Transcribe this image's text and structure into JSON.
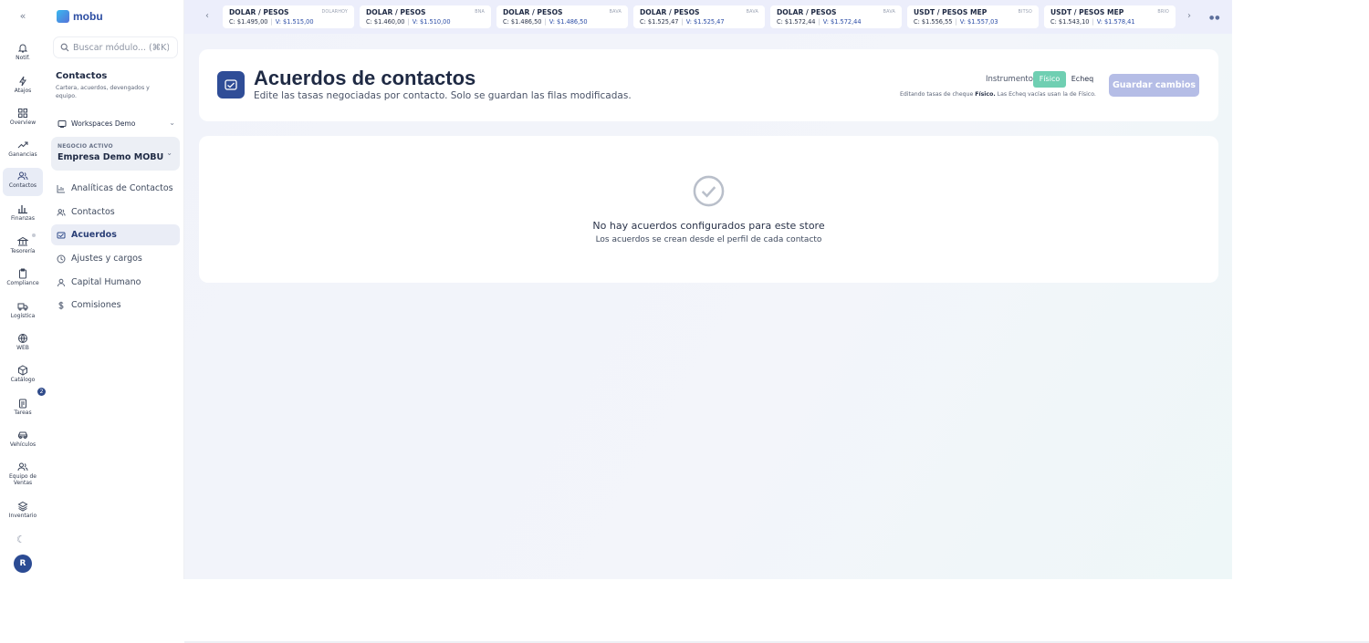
{
  "rail": {
    "items": [
      {
        "label": "Notif."
      },
      {
        "label": "Atajos"
      },
      {
        "label": "Overview"
      },
      {
        "label": "Ganancias"
      },
      {
        "label": "Contactos"
      },
      {
        "label": "Finanzas"
      },
      {
        "label": "Tesorería"
      },
      {
        "label": "Compliance"
      },
      {
        "label": "Logística"
      },
      {
        "label": "WEB"
      },
      {
        "label": "Catálogo"
      },
      {
        "label": "Tareas"
      },
      {
        "label": "Vehículos"
      },
      {
        "label": "Equipo de Ventas"
      },
      {
        "label": "Inventario"
      }
    ],
    "tasks_badge": "2",
    "avatar_initial": "R"
  },
  "sidebar": {
    "logo": "mobu",
    "search_placeholder": "Buscar módulo... (⌘K)",
    "section_title": "Contactos",
    "section_subtitle": "Cartera, acuerdos, devengados y equipo.",
    "workspace": "Workspaces Demo",
    "business_label": "NEGOCIO ACTIVO",
    "business_name": "Empresa Demo MOBU",
    "nav": [
      {
        "label": "Analíticas de Contactos"
      },
      {
        "label": "Contactos"
      },
      {
        "label": "Acuerdos"
      },
      {
        "label": "Ajustes y cargos"
      },
      {
        "label": "Capital Humano"
      },
      {
        "label": "Comisiones"
      }
    ]
  },
  "rates": [
    {
      "pair": "DOLAR / PESOS",
      "source": "DOLARHOY",
      "buy": "C: $1.495,00",
      "sell": "V: $1.515,00"
    },
    {
      "pair": "DOLAR / PESOS",
      "source": "BNA",
      "buy": "C: $1.460,00",
      "sell": "V: $1.510,00"
    },
    {
      "pair": "DOLAR / PESOS",
      "source": "BAVA",
      "buy": "C: $1.486,50",
      "sell": "V: $1.486,50"
    },
    {
      "pair": "DOLAR / PESOS",
      "source": "BAVA",
      "buy": "C: $1.525,47",
      "sell": "V: $1.525,47"
    },
    {
      "pair": "DOLAR / PESOS",
      "source": "BAVA",
      "buy": "C: $1.572,44",
      "sell": "V: $1.572,44"
    },
    {
      "pair": "USDT / PESOS MEP",
      "source": "BITSO",
      "buy": "C: $1.556,55",
      "sell": "V: $1.557,03"
    },
    {
      "pair": "USDT / PESOS MEP",
      "source": "BRIO",
      "buy": "C: $1.543,10",
      "sell": "V: $1.578,41"
    }
  ],
  "header": {
    "title": "Acuerdos de contactos",
    "subtitle": "Edite las tasas negociadas por contacto. Solo se guardan las filas modificadas.",
    "instrument_label": "Instrumento:",
    "instrument_options": [
      "Físico",
      "Echeq"
    ],
    "instrument_selected": "Físico",
    "note_prefix": "Editando tasas de cheque",
    "note_bold": "Físico.",
    "note_suffix": "Las Echeq vacías usan la de Físico.",
    "save_label": "Guardar cambios"
  },
  "empty": {
    "title": "No hay acuerdos configurados para este store",
    "subtitle": "Los acuerdos se crean desde el perfil de cada contacto"
  }
}
